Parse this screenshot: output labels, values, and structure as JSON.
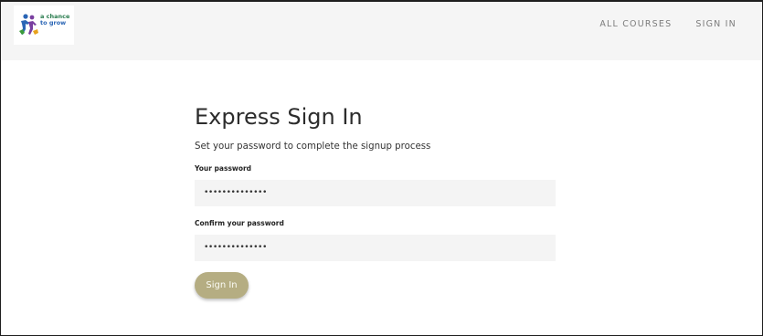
{
  "brand": {
    "logo_line1": "a chance",
    "logo_line2": "to grow",
    "logo_icon": "people-icon"
  },
  "nav": {
    "items": [
      {
        "label": "ALL COURSES"
      },
      {
        "label": "SIGN IN"
      }
    ]
  },
  "form": {
    "title": "Express Sign In",
    "subtitle": "Set your password to complete the signup process",
    "password_label": "Your password",
    "password_value": "••••••••••••••",
    "confirm_label": "Confirm your password",
    "confirm_value": "••••••••••••••",
    "submit_label": "Sign In"
  },
  "colors": {
    "header_bg": "#f5f5f5",
    "button_bg": "#b5ad82",
    "field_bg": "#f4f4f4",
    "nav_text": "#7c7c7c"
  }
}
